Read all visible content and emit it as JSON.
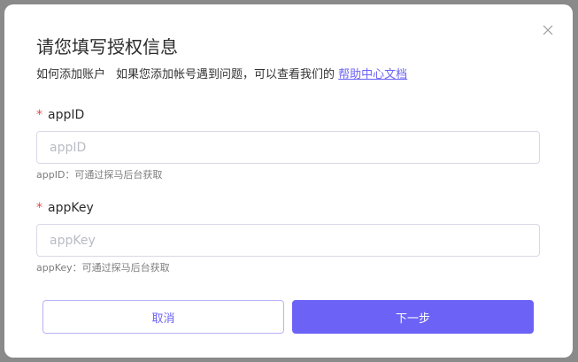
{
  "dialog": {
    "title": "请您填写授权信息",
    "help_prefix": "如何添加账户",
    "help_text": "如果您添加帐号遇到问题，可以查看我们的",
    "help_link": "帮助中心文档"
  },
  "fields": [
    {
      "required_mark": "*",
      "label": "appID",
      "placeholder": "appID",
      "value": "",
      "hint": "appID：可通过探马后台获取"
    },
    {
      "required_mark": "*",
      "label": "appKey",
      "placeholder": "appKey",
      "value": "",
      "hint": "appKey：可通过探马后台获取"
    }
  ],
  "buttons": {
    "cancel": "取消",
    "next": "下一步"
  },
  "colors": {
    "accent": "#6c63f6",
    "required": "#e5484d",
    "overlay": "#8a8a8a"
  },
  "icons": {
    "close": "close-icon"
  }
}
